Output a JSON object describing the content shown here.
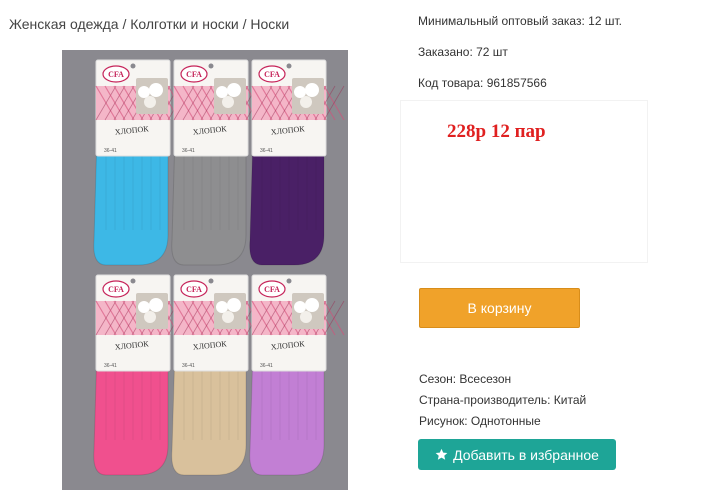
{
  "breadcrumb": {
    "items": [
      "Женская одежда",
      "Колготки и носки",
      "Носки"
    ],
    "separator": "/"
  },
  "product_info": {
    "min_order": "Минимальный оптовый заказ: 12 шт.",
    "ordered": "Заказано: 72 шт",
    "product_code": "Код товара: 961857566"
  },
  "price": {
    "text": "228р 12 пар",
    "color": "#e02020"
  },
  "cart_button": {
    "label": "В корзину",
    "color": "#f0a22a"
  },
  "properties": {
    "season": "Сезон: Всесезон",
    "country": "Страна-производитель: Китай",
    "pattern": "Рисунок: Однотонные"
  },
  "favorite_button": {
    "label": "Добавить в избранное",
    "icon": "star-icon",
    "color": "#1ea597"
  },
  "product_image": {
    "brand": "CFA",
    "label_title": "ХЛОПОК",
    "label_size": "36-41",
    "sock_colors": [
      "#3db8e6",
      "#8e8e90",
      "#4a2066",
      "#f0508e",
      "#d9c19c",
      "#c27fd4"
    ]
  }
}
